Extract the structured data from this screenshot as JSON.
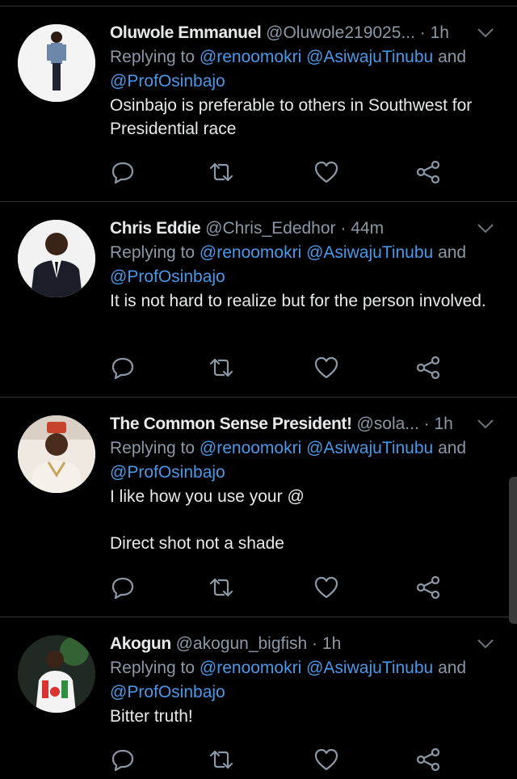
{
  "tweets": [
    {
      "name": "Oluwole Emmanuel",
      "handle": "@Oluwole219025...",
      "dot": " · ",
      "time": "1h",
      "reply_prefix": "Replying to ",
      "mention1": "@renoomokri",
      "mention2": "@AsiwajuTinubu",
      "and": " and",
      "mention3": "@ProfOsinbajo",
      "text": "Osinbajo is preferable to others in Southwest for Presidential race"
    },
    {
      "name": "Chris Eddie",
      "handle": "@Chris_Ededhor",
      "dot": " · ",
      "time": "44m",
      "reply_prefix": "Replying to ",
      "mention1": "@renoomokri",
      "mention2": "@AsiwajuTinubu",
      "and": " and",
      "mention3": "@ProfOsinbajo",
      "text": "It is not hard to realize but for the person involved."
    },
    {
      "name": "The Common Sense President!",
      "handle": "@sola...",
      "dot": " · ",
      "time": "1h",
      "reply_prefix": "Replying to ",
      "mention1": "@renoomokri",
      "mention2": "@AsiwajuTinubu",
      "and": " and",
      "mention3": "@ProfOsinbajo",
      "text": "I like how you use your @\n\nDirect shot not a shade"
    },
    {
      "name": "Akogun",
      "handle": "@akogun_bigfish",
      "dot": " · ",
      "time": "1h",
      "reply_prefix": "Replying to ",
      "mention1": "@renoomokri",
      "mention2": "@AsiwajuTinubu",
      "and": " and",
      "mention3": "@ProfOsinbajo",
      "text": "Bitter truth!"
    }
  ],
  "colors": {
    "background": "#000000",
    "name": "#e7e9ea",
    "secondary": "#8b98a5",
    "mention": "#4a99e9",
    "divider": "#2f3336"
  },
  "icons": {
    "reply": "reply-icon",
    "retweet": "retweet-icon",
    "like": "like-icon",
    "share": "share-icon",
    "more": "chevron-down-icon"
  }
}
